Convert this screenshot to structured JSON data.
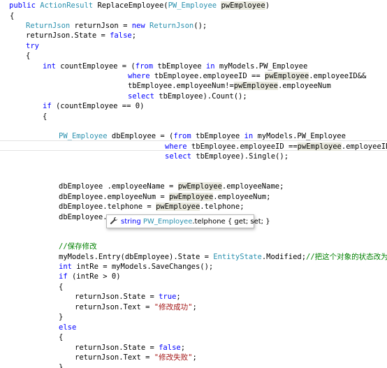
{
  "code": {
    "l01_kw": "public",
    "l01_type": "ActionResult",
    "l01_name": " ReplaceEmployee(",
    "l01_ptype": "PW_Employee",
    "l01_sp": " ",
    "l01_param": "pwEmployee",
    "l01_end": ")",
    "l02": "{",
    "l03_type": "ReturnJson",
    "l03_mid": " returnJson = ",
    "l03_new": "new",
    "l03_sp": " ",
    "l03_type2": "ReturnJson",
    "l03_end": "();",
    "l04_a": "returnJson.State = ",
    "l04_kw": "false",
    "l04_end": ";",
    "l05_kw": "try",
    "l06": "{",
    "l07_kw": "int",
    "l07_a": " countEmployee = (",
    "l07_from": "from",
    "l07_b": " tbEmployee ",
    "l07_in": "in",
    "l07_c": " myModels.PW_Employee",
    "l08_where": "where",
    "l08_a": " tbEmployee.employeeID == ",
    "l08_hl": "pwEmployee",
    "l08_b": ".employeeID&&",
    "l09_a": "tbEmployee.employeeNum!=",
    "l09_hl": "pwEmployee",
    "l09_b": ".employeeNum",
    "l10_select": "select",
    "l10_a": " tbEmployee).Count();",
    "l11_if": "if",
    "l11_a": " (countEmployee == 0)",
    "l12": "{",
    "l14_type": "PW_Employee",
    "l14_a": " dbEmployee = (",
    "l14_from": "from",
    "l14_b": " tbEmployee ",
    "l14_in": "in",
    "l14_c": " myModels.PW_Employee",
    "l15_where": "where",
    "l15_a": " tbEmployee.employeeID ==",
    "l15_hl": "pwEmployee",
    "l15_b": ".employeeID",
    "l16_select": "select",
    "l16_a": " tbEmployee).Single();",
    "l19_a": "dbEmployee .employeeName = ",
    "l19_hl": "pwEmployee",
    "l19_b": ".employeeName;",
    "l20_a": "dbEmployee.employeeNum = ",
    "l20_hl": "pwEmployee",
    "l20_b": ".employeeNum;",
    "l21_a": "dbEmployee.telphone = ",
    "l21_hl": "pwEmployee",
    "l21_b": ".telphone;",
    "l22_a": "dbEmployee.a",
    "l24_comment": "//保存修改",
    "l25_a": "myModels.Entry(dbEmployee).State = ",
    "l25_type": "EntityState",
    "l25_b": ".Modified;",
    "l25_comment": "//把这个对象的状态改为修改",
    "l26_kw": "int",
    "l26_a": " intRe = myModels.SaveChanges();",
    "l27_if": "if",
    "l27_a": " (intRe > 0)",
    "l28": "{",
    "l29_a": "returnJson.State = ",
    "l29_kw": "true",
    "l29_end": ";",
    "l30_a": "returnJson.Text = ",
    "l30_str": "\"修改成功\"",
    "l30_end": ";",
    "l31": "}",
    "l32_else": "else",
    "l33": "{",
    "l34_a": "returnJson.State = ",
    "l34_kw": "false",
    "l34_end": ";",
    "l35_a": "returnJson.Text = ",
    "l35_str": "\"修改失败\"",
    "l35_end": ";",
    "l36": "}"
  },
  "tooltip": {
    "icon": "wrench-icon",
    "kw": "string",
    "sp": " ",
    "type": "PW_Employee",
    "member": ".telphone",
    "accessors": " { get; set; }"
  }
}
